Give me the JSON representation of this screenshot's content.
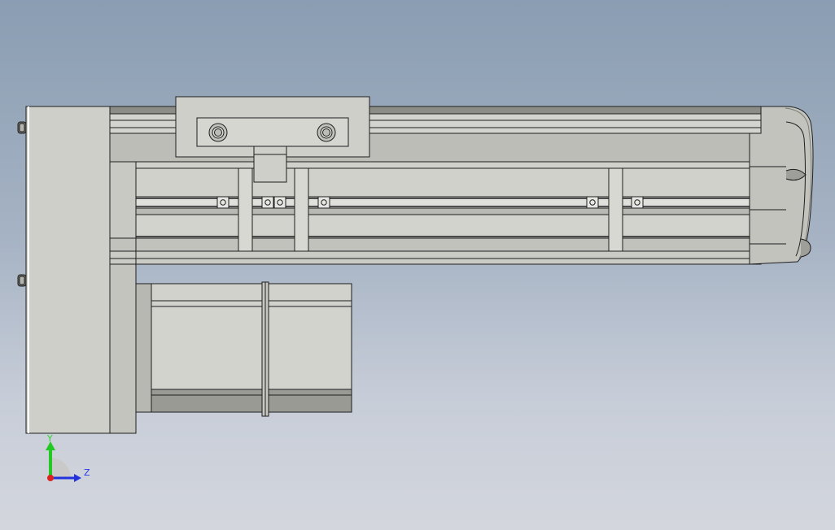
{
  "viewport": {
    "background_top": "#8a9db2",
    "background_bottom": "#d3d6dd"
  },
  "model": {
    "part_color": "#cfcfca",
    "shadow_color": "#9c9c96",
    "edge_color": "#1e1e1e"
  },
  "triad": {
    "y_label": "Y",
    "z_label": "Z",
    "y_color": "#22c922",
    "z_color": "#2233dd",
    "x_color": "#dd2222"
  }
}
